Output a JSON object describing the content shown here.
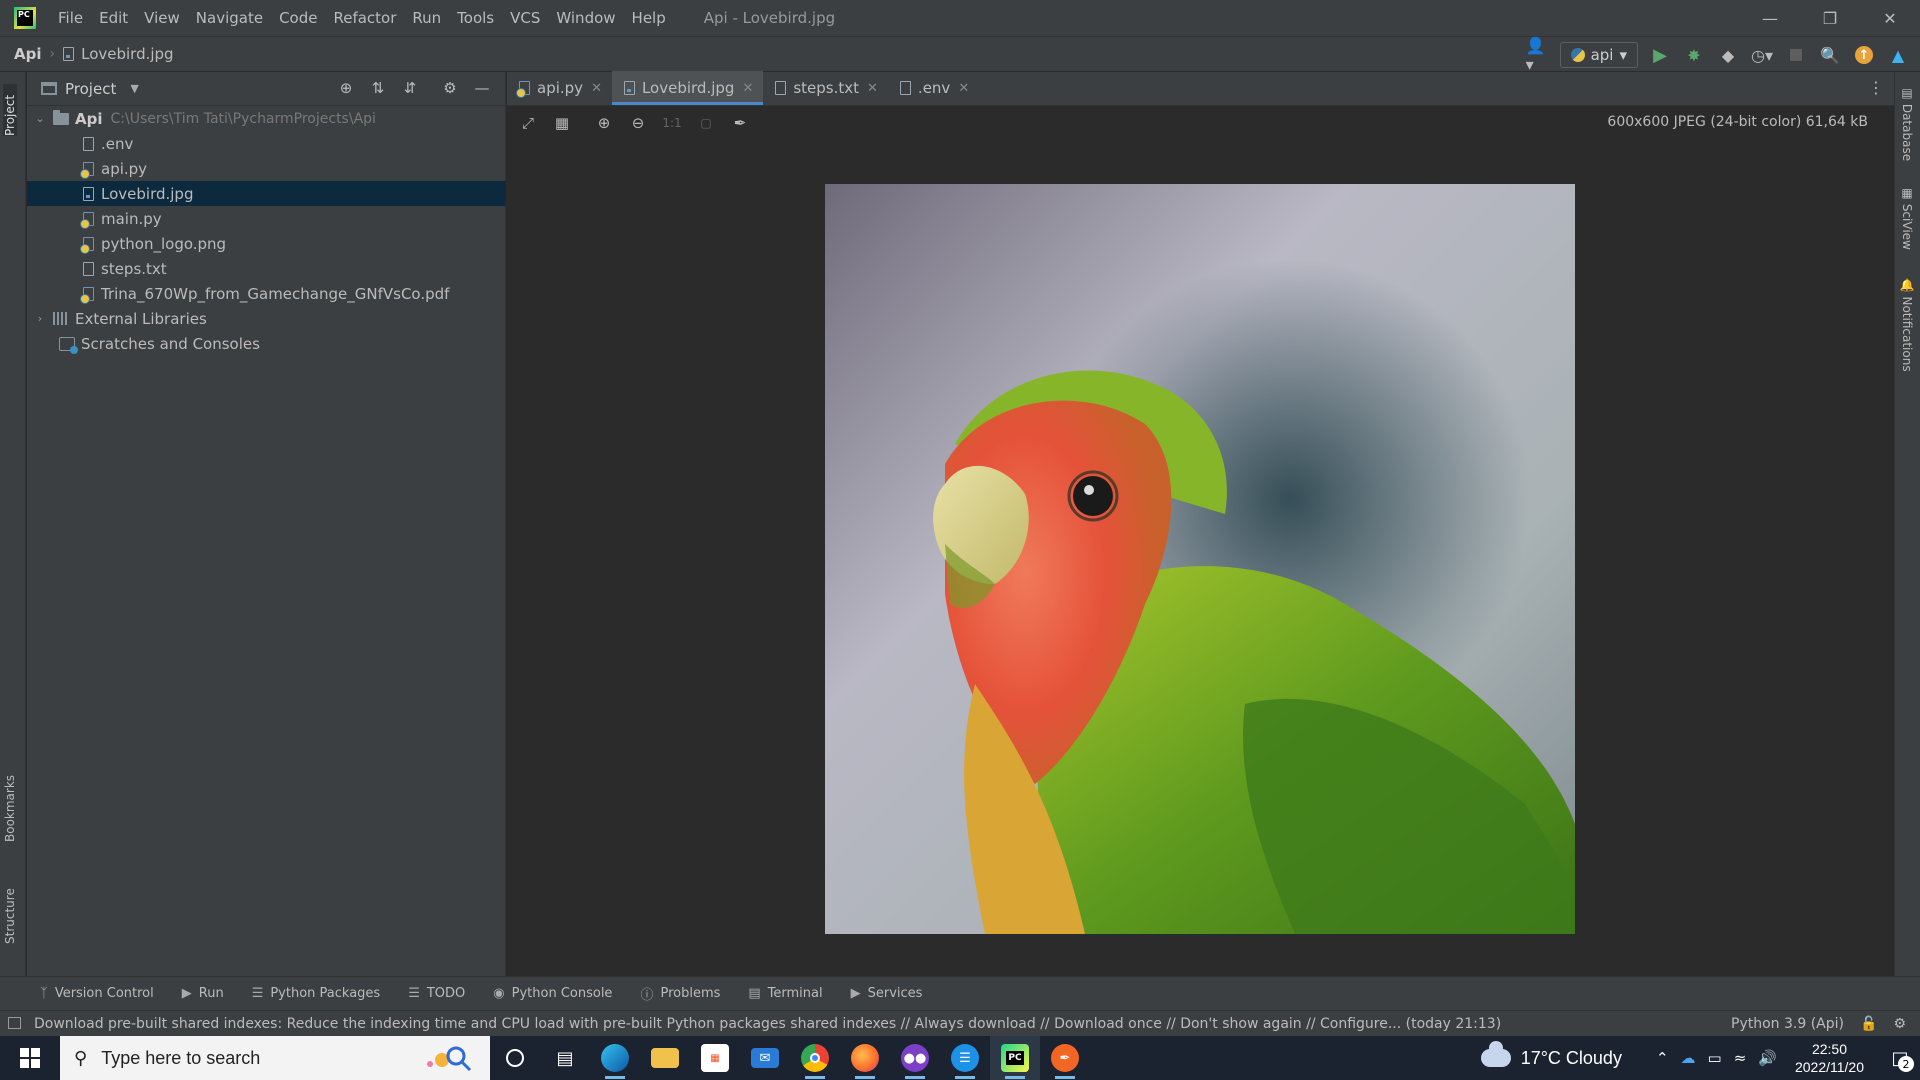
{
  "titlebar": {
    "menu": [
      "File",
      "Edit",
      "View",
      "Navigate",
      "Code",
      "Refactor",
      "Run",
      "Tools",
      "VCS",
      "Window",
      "Help"
    ],
    "window_title": "Api - Lovebird.jpg",
    "logo_text": "PC"
  },
  "navbar": {
    "project": "Api",
    "file": "Lovebird.jpg",
    "run_config": "api"
  },
  "project_panel": {
    "title": "Project",
    "root": {
      "name": "Api",
      "path": "C:\\Users\\Tim Tati\\PycharmProjects\\Api"
    },
    "files": [
      {
        "name": ".env",
        "type": "text"
      },
      {
        "name": "api.py",
        "type": "py"
      },
      {
        "name": "Lovebird.jpg",
        "type": "img",
        "selected": true
      },
      {
        "name": "main.py",
        "type": "py"
      },
      {
        "name": "python_logo.png",
        "type": "img"
      },
      {
        "name": "steps.txt",
        "type": "text"
      },
      {
        "name": "Trina_670Wp_from_Gamechange_GNfVsCo.pdf",
        "type": "pdf"
      }
    ],
    "external_libraries": "External Libraries",
    "scratches": "Scratches and Consoles"
  },
  "editor": {
    "tabs": [
      {
        "label": "api.py",
        "type": "py",
        "active": false
      },
      {
        "label": "Lovebird.jpg",
        "type": "img",
        "active": true
      },
      {
        "label": "steps.txt",
        "type": "text",
        "active": false
      },
      {
        "label": ".env",
        "type": "text",
        "active": false
      }
    ],
    "zoom_actual": "1:1",
    "image_info": "600x600 JPEG (24-bit color) 61,64 kB"
  },
  "side_strips": {
    "left_top": "Project",
    "left_bookmarks": "Bookmarks",
    "left_structure": "Structure",
    "right_database": "Database",
    "right_sciview": "SciView",
    "right_notifications": "Notifications"
  },
  "bottom_tools": [
    "Version Control",
    "Run",
    "Python Packages",
    "TODO",
    "Python Console",
    "Problems",
    "Terminal",
    "Services"
  ],
  "status": {
    "message": "Download pre-built shared indexes: Reduce the indexing time and CPU load with pre-built Python packages shared indexes // Always download // Download once // Don't show again // Configure... (today 21:13)",
    "interpreter": "Python 3.9 (Api)"
  },
  "taskbar": {
    "search_placeholder": "Type here to search",
    "weather": "17°C  Cloudy",
    "time": "22:50",
    "date": "2022/11/20",
    "notification_count": "2",
    "pinned": [
      "cortana",
      "task-view",
      "edge",
      "file-explorer",
      "microsoft-store",
      "mail",
      "chrome",
      "firefox",
      "app-purple",
      "docker",
      "pycharm",
      "app-orange"
    ]
  },
  "colors": {
    "accent": "#4a88c7",
    "selection": "#0d293e",
    "panel": "#3c3f41",
    "editor_bg": "#2b2b2b",
    "taskbar": "#1c2330"
  }
}
